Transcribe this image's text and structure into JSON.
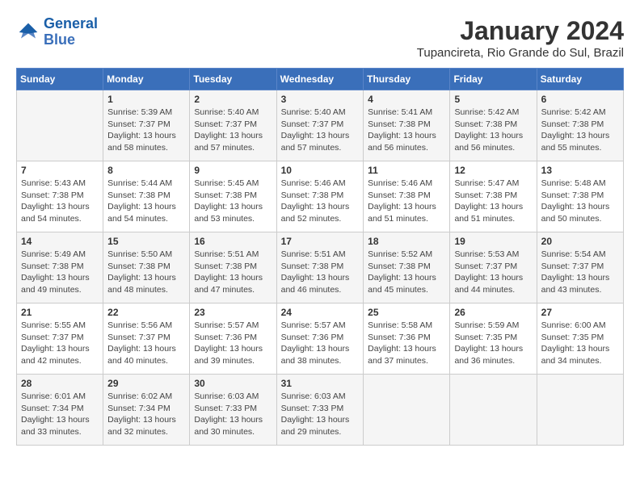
{
  "logo": {
    "line1": "General",
    "line2": "Blue"
  },
  "title": "January 2024",
  "location": "Tupancireta, Rio Grande do Sul, Brazil",
  "days_header": [
    "Sunday",
    "Monday",
    "Tuesday",
    "Wednesday",
    "Thursday",
    "Friday",
    "Saturday"
  ],
  "weeks": [
    [
      {
        "num": "",
        "info": ""
      },
      {
        "num": "1",
        "info": "Sunrise: 5:39 AM\nSunset: 7:37 PM\nDaylight: 13 hours\nand 58 minutes."
      },
      {
        "num": "2",
        "info": "Sunrise: 5:40 AM\nSunset: 7:37 PM\nDaylight: 13 hours\nand 57 minutes."
      },
      {
        "num": "3",
        "info": "Sunrise: 5:40 AM\nSunset: 7:37 PM\nDaylight: 13 hours\nand 57 minutes."
      },
      {
        "num": "4",
        "info": "Sunrise: 5:41 AM\nSunset: 7:38 PM\nDaylight: 13 hours\nand 56 minutes."
      },
      {
        "num": "5",
        "info": "Sunrise: 5:42 AM\nSunset: 7:38 PM\nDaylight: 13 hours\nand 56 minutes."
      },
      {
        "num": "6",
        "info": "Sunrise: 5:42 AM\nSunset: 7:38 PM\nDaylight: 13 hours\nand 55 minutes."
      }
    ],
    [
      {
        "num": "7",
        "info": "Sunrise: 5:43 AM\nSunset: 7:38 PM\nDaylight: 13 hours\nand 54 minutes."
      },
      {
        "num": "8",
        "info": "Sunrise: 5:44 AM\nSunset: 7:38 PM\nDaylight: 13 hours\nand 54 minutes."
      },
      {
        "num": "9",
        "info": "Sunrise: 5:45 AM\nSunset: 7:38 PM\nDaylight: 13 hours\nand 53 minutes."
      },
      {
        "num": "10",
        "info": "Sunrise: 5:46 AM\nSunset: 7:38 PM\nDaylight: 13 hours\nand 52 minutes."
      },
      {
        "num": "11",
        "info": "Sunrise: 5:46 AM\nSunset: 7:38 PM\nDaylight: 13 hours\nand 51 minutes."
      },
      {
        "num": "12",
        "info": "Sunrise: 5:47 AM\nSunset: 7:38 PM\nDaylight: 13 hours\nand 51 minutes."
      },
      {
        "num": "13",
        "info": "Sunrise: 5:48 AM\nSunset: 7:38 PM\nDaylight: 13 hours\nand 50 minutes."
      }
    ],
    [
      {
        "num": "14",
        "info": "Sunrise: 5:49 AM\nSunset: 7:38 PM\nDaylight: 13 hours\nand 49 minutes."
      },
      {
        "num": "15",
        "info": "Sunrise: 5:50 AM\nSunset: 7:38 PM\nDaylight: 13 hours\nand 48 minutes."
      },
      {
        "num": "16",
        "info": "Sunrise: 5:51 AM\nSunset: 7:38 PM\nDaylight: 13 hours\nand 47 minutes."
      },
      {
        "num": "17",
        "info": "Sunrise: 5:51 AM\nSunset: 7:38 PM\nDaylight: 13 hours\nand 46 minutes."
      },
      {
        "num": "18",
        "info": "Sunrise: 5:52 AM\nSunset: 7:38 PM\nDaylight: 13 hours\nand 45 minutes."
      },
      {
        "num": "19",
        "info": "Sunrise: 5:53 AM\nSunset: 7:37 PM\nDaylight: 13 hours\nand 44 minutes."
      },
      {
        "num": "20",
        "info": "Sunrise: 5:54 AM\nSunset: 7:37 PM\nDaylight: 13 hours\nand 43 minutes."
      }
    ],
    [
      {
        "num": "21",
        "info": "Sunrise: 5:55 AM\nSunset: 7:37 PM\nDaylight: 13 hours\nand 42 minutes."
      },
      {
        "num": "22",
        "info": "Sunrise: 5:56 AM\nSunset: 7:37 PM\nDaylight: 13 hours\nand 40 minutes."
      },
      {
        "num": "23",
        "info": "Sunrise: 5:57 AM\nSunset: 7:36 PM\nDaylight: 13 hours\nand 39 minutes."
      },
      {
        "num": "24",
        "info": "Sunrise: 5:57 AM\nSunset: 7:36 PM\nDaylight: 13 hours\nand 38 minutes."
      },
      {
        "num": "25",
        "info": "Sunrise: 5:58 AM\nSunset: 7:36 PM\nDaylight: 13 hours\nand 37 minutes."
      },
      {
        "num": "26",
        "info": "Sunrise: 5:59 AM\nSunset: 7:35 PM\nDaylight: 13 hours\nand 36 minutes."
      },
      {
        "num": "27",
        "info": "Sunrise: 6:00 AM\nSunset: 7:35 PM\nDaylight: 13 hours\nand 34 minutes."
      }
    ],
    [
      {
        "num": "28",
        "info": "Sunrise: 6:01 AM\nSunset: 7:34 PM\nDaylight: 13 hours\nand 33 minutes."
      },
      {
        "num": "29",
        "info": "Sunrise: 6:02 AM\nSunset: 7:34 PM\nDaylight: 13 hours\nand 32 minutes."
      },
      {
        "num": "30",
        "info": "Sunrise: 6:03 AM\nSunset: 7:33 PM\nDaylight: 13 hours\nand 30 minutes."
      },
      {
        "num": "31",
        "info": "Sunrise: 6:03 AM\nSunset: 7:33 PM\nDaylight: 13 hours\nand 29 minutes."
      },
      {
        "num": "",
        "info": ""
      },
      {
        "num": "",
        "info": ""
      },
      {
        "num": "",
        "info": ""
      }
    ]
  ]
}
